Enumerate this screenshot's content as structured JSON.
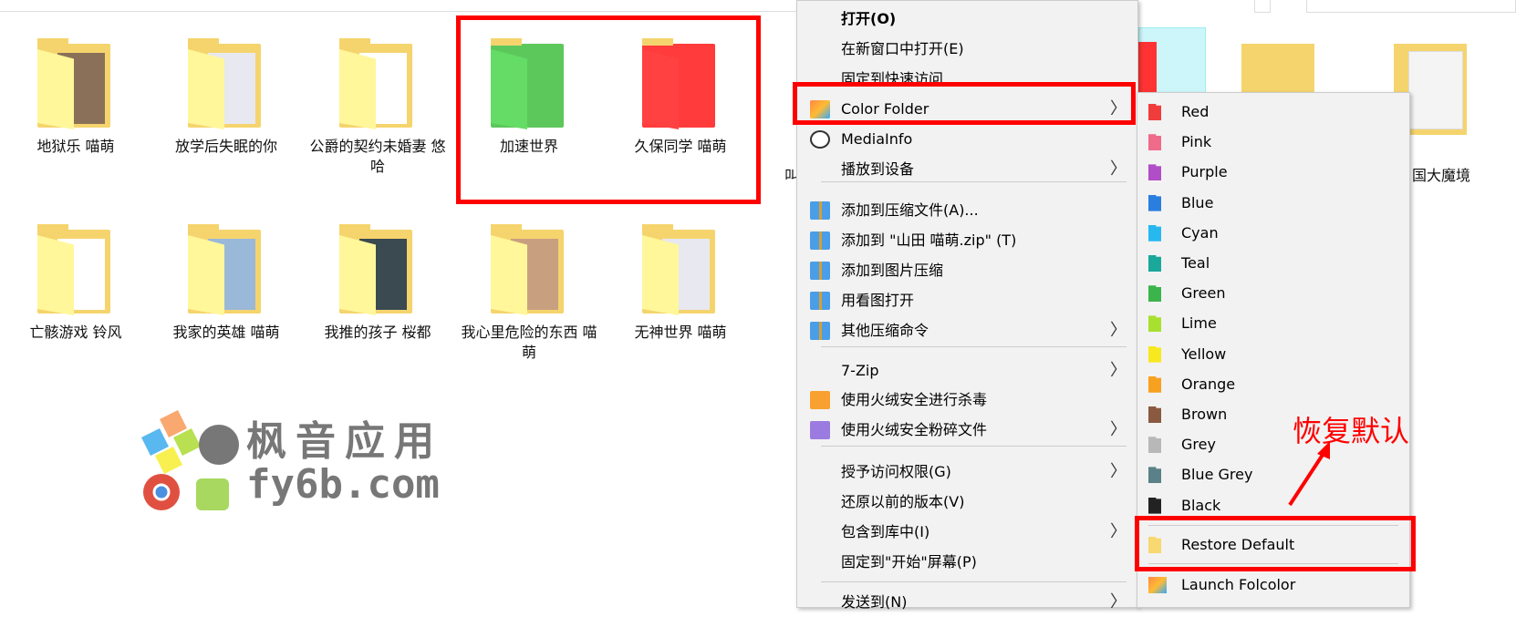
{
  "folders_row1": [
    {
      "label": "地狱乐 喵萌",
      "color": "#f5d46d",
      "preview": "#8a7058"
    },
    {
      "label": "放学后失眠的你",
      "color": "#f5d46d",
      "preview": "#e8e8f0"
    },
    {
      "label": "公爵的契约未婚妻 悠哈",
      "color": "#f5d46d",
      "preview": "#ffffff"
    },
    {
      "label": "加速世界",
      "color": "#5cc85c",
      "preview": "#5cc85c"
    },
    {
      "label": "久保同学 喵萌",
      "color": "#ff3b3b",
      "preview": "#ff3b3b"
    }
  ],
  "folders_row2": [
    {
      "label": "亡骸游戏 铃风",
      "color": "#f5d46d",
      "preview": "#ffffff"
    },
    {
      "label": "我家的英雄 喵萌",
      "color": "#f5d46d",
      "preview": "#9ab8d8"
    },
    {
      "label": "我推的孩子 桜都",
      "color": "#f5d46d",
      "preview": "#3a4a50"
    },
    {
      "label": "我心里危险的东西 喵萌",
      "color": "#f5d46d",
      "preview": "#c8a080"
    },
    {
      "label": "无神世界 喵萌",
      "color": "#f5d46d",
      "preview": "#e8e8f0"
    }
  ],
  "partial_folder_label": "国大魔境",
  "partial_cut_label": "叫",
  "context_menu": {
    "items": [
      {
        "label": "打开(O)",
        "bold": true
      },
      {
        "label": "在新窗口中打开(E)"
      },
      {
        "label": "固定到快速访问"
      },
      {
        "label": "Color Folder",
        "icon": "color-folder-icon",
        "submenu": true
      },
      {
        "label": "MediaInfo",
        "icon": "mediainfo-icon"
      },
      {
        "label": "播放到设备",
        "submenu": true
      },
      {
        "label": "添加到压缩文件(A)...",
        "icon": "archive-icon"
      },
      {
        "label": "添加到 \"山田 喵萌.zip\" (T)",
        "icon": "archive-icon"
      },
      {
        "label": "添加到图片压缩",
        "icon": "archive-icon"
      },
      {
        "label": "用看图打开",
        "icon": "archive-icon"
      },
      {
        "label": "其他压缩命令",
        "icon": "archive-icon",
        "submenu": true
      },
      {
        "label": "7-Zip",
        "submenu": true
      },
      {
        "label": "使用火绒安全进行杀毒",
        "icon": "huorong-shield-icon"
      },
      {
        "label": "使用火绒安全粉碎文件",
        "icon": "shredder-icon",
        "submenu": true
      },
      {
        "label": "授予访问权限(G)",
        "submenu": true
      },
      {
        "label": "还原以前的版本(V)"
      },
      {
        "label": "包含到库中(I)",
        "submenu": true
      },
      {
        "label": "固定到\"开始\"屏幕(P)"
      },
      {
        "label": "发送到(N)",
        "submenu": true
      }
    ],
    "arrow": "〉"
  },
  "color_submenu": {
    "items": [
      {
        "label": "Red",
        "color": "#f03c3c"
      },
      {
        "label": "Pink",
        "color": "#f06a8a"
      },
      {
        "label": "Purple",
        "color": "#b04ec8"
      },
      {
        "label": "Blue",
        "color": "#2a7ee0"
      },
      {
        "label": "Cyan",
        "color": "#28b8f0"
      },
      {
        "label": "Teal",
        "color": "#1aa89a"
      },
      {
        "label": "Green",
        "color": "#3cb44c"
      },
      {
        "label": "Lime",
        "color": "#a8e030"
      },
      {
        "label": "Yellow",
        "color": "#f8e820"
      },
      {
        "label": "Orange",
        "color": "#f8a020"
      },
      {
        "label": "Brown",
        "color": "#8a5a40"
      },
      {
        "label": "Grey",
        "color": "#b8b8b8"
      },
      {
        "label": "Blue Grey",
        "color": "#5a8088"
      },
      {
        "label": "Black",
        "color": "#222222"
      }
    ],
    "restore": {
      "label": "Restore Default",
      "color": "#f8d870"
    },
    "launch": {
      "label": "Launch Folcolor"
    }
  },
  "annotation": "恢复默认",
  "watermark": {
    "line1": "枫音应用",
    "line2": "fy6b.com"
  },
  "highlight_color": "#ff0000"
}
